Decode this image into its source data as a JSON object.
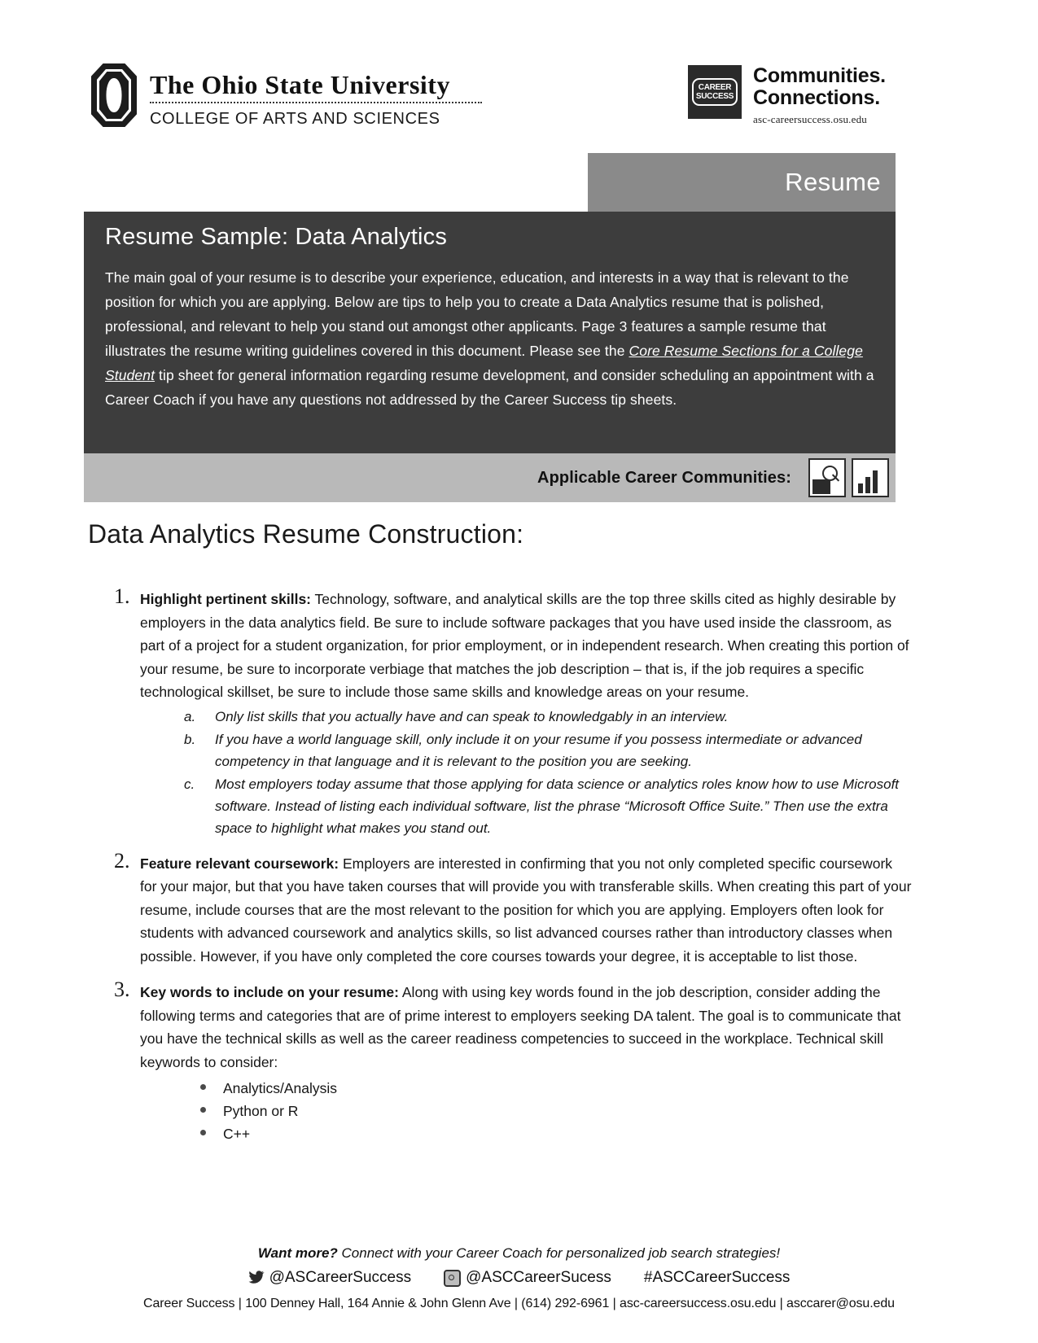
{
  "header": {
    "university_name_line1": "The Ohio State University",
    "college_name": "COLLEGE OF ARTS AND SCIENCES",
    "career_success_logo_line1": "CAREER",
    "career_success_logo_line2": "SUCCESS",
    "tagline_line1": "Communities.",
    "tagline_line2": "Connections.",
    "tagline_url": "asc-careersuccess.osu.edu"
  },
  "tab": {
    "label": "Resume"
  },
  "banner": {
    "title": "Resume Sample: Data Analytics",
    "body_part1": "The main goal of your resume is to describe your experience, education, and interests in a way that is relevant to the position for which you are applying. Below are tips to help you to create a Data Analytics resume that is polished, professional, and relevant to help you stand out amongst other applicants. Page 3 features a sample resume that illustrates the resume writing guidelines covered in this document. Please see the ",
    "body_link": "Core Resume Sections for a College Student",
    "body_part2": " tip sheet for general information regarding resume development, and consider scheduling an appointment with a Career Coach if you have any questions not addressed by the Career Success tip sheets."
  },
  "communities": {
    "label": "Applicable Career Communities:"
  },
  "main": {
    "heading": "Data Analytics Resume Construction:",
    "items": [
      {
        "number": "1.",
        "lead": "Highlight pertinent skills:",
        "text": " Technology, software, and analytical skills are the top three skills cited as highly desirable by employers in the data analytics field. Be sure to include software packages that you have used inside the classroom, as part of a project for a student organization, for prior employment, or in independent research. When creating this portion of your resume, be sure to incorporate verbiage that matches the job description – that is, if the job requires a specific technological skillset, be sure to include those same skills and knowledge areas on your resume.",
        "subitems": [
          {
            "marker": "a.",
            "text": "Only list skills that you actually have and can speak to knowledgably in an interview."
          },
          {
            "marker": "b.",
            "text": "If you have a world language skill, only include it on your resume if you possess intermediate or advanced competency in that language and it is relevant to the position you are seeking."
          },
          {
            "marker": "c.",
            "text": "Most employers today assume that those applying for data science or analytics roles know how to use Microsoft software. Instead of listing each individual software, list the phrase “Microsoft Office Suite.” Then use the extra space to highlight what makes you stand out."
          }
        ]
      },
      {
        "number": "2.",
        "lead": "Feature relevant coursework:",
        "text": " Employers are interested in confirming that you not only completed specific coursework for your major, but that you have taken courses that will provide you with transferable skills. When creating this part of your resume, include courses that are the most relevant to the position for which you are applying. Employers often look for students with advanced coursework and analytics skills, so list advanced courses rather than introductory classes when possible. However, if you have only completed the core courses towards your degree, it is acceptable to list those.",
        "subitems": []
      },
      {
        "number": "3.",
        "lead": "Key words to include on your resume:",
        "text": " Along with using key words found in the job description, consider adding the following terms and categories that are of prime interest to employers seeking DA talent. The goal is to communicate that you have the technical skills as well as the career readiness competencies to succeed in the workplace. Technical skill keywords to consider:",
        "subitems": []
      }
    ],
    "keyword_bullets": [
      "Analytics/Analysis",
      "Python or R",
      "C++"
    ]
  },
  "footer": {
    "tagline_bold": "Want more?",
    "tagline_rest": " Connect with your Career Coach for personalized job search strategies!",
    "twitter_handle": "@ASCareerSuccess",
    "instagram_handle": "@ASCCareerSucess",
    "hashtag": "#ASCCareerSuccess",
    "contact_line": "Career Success | 100 Denney Hall, 164 Annie & John Glenn Ave | (614) 292-6961 | asc-careersuccess.osu.edu | asccarer@osu.edu"
  },
  "colors": {
    "banner_dark": "#3d3d3d",
    "tab_gray": "#8a8a8a",
    "strip_gray": "#b9b9b9"
  }
}
